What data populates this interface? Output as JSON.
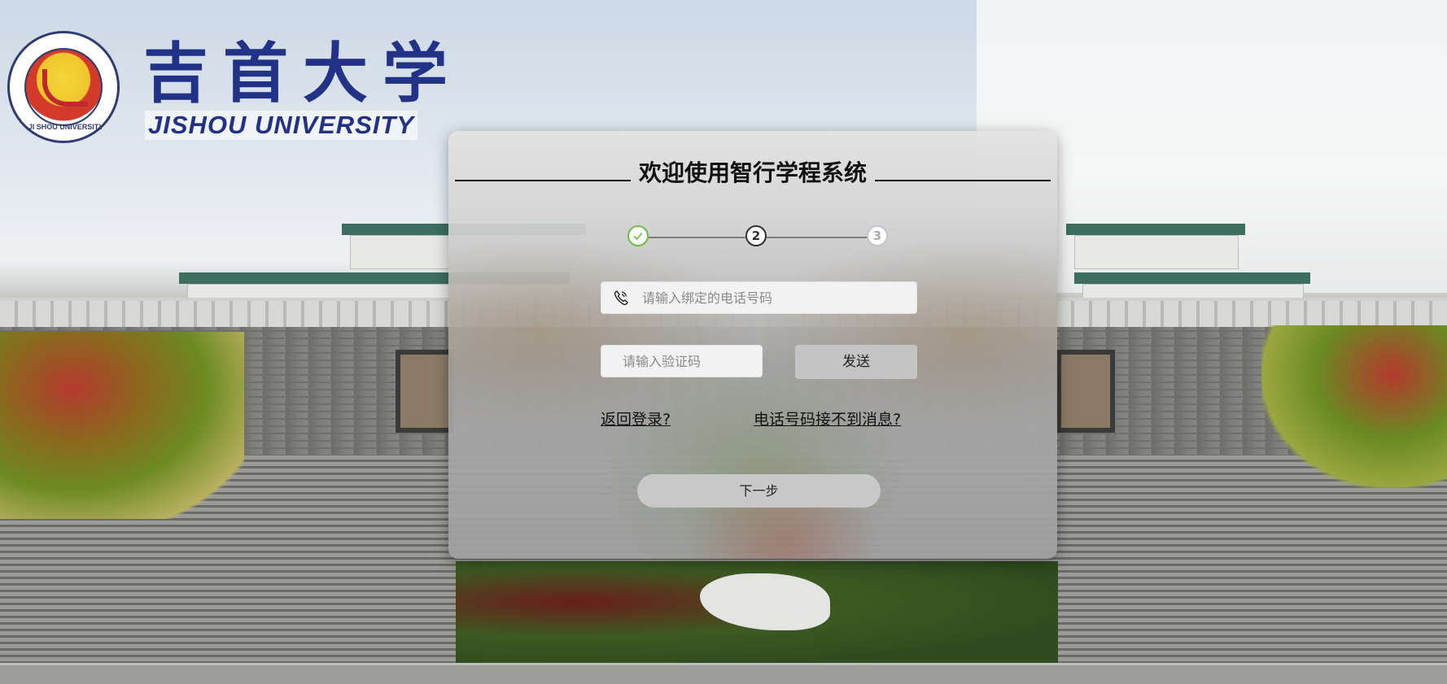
{
  "logo": {
    "chinese_name": "吉首大学",
    "english_name": "JISHOU  UNIVERSITY",
    "seal_text": "JI SHOU UNIVERSITY"
  },
  "card": {
    "title": "欢迎使用智行学程系统",
    "steps": [
      {
        "label": "✓",
        "state": "done"
      },
      {
        "label": "2",
        "state": "active"
      },
      {
        "label": "3",
        "state": "todo"
      }
    ],
    "phone_input": {
      "placeholder": "请输入绑定的电话号码",
      "value": ""
    },
    "code_input": {
      "placeholder": "请输入验证码",
      "value": ""
    },
    "send_button": "发送",
    "back_link": "返回登录?",
    "no_message_link": "电话号码接不到消息?",
    "next_button": "下一步"
  },
  "colors": {
    "step_done": "#67c23a",
    "step_active": "#303133",
    "step_todo": "#c0c4cc",
    "logo_blue": "#213287"
  },
  "icons": {
    "phone": "phone-icon",
    "check": "check-icon"
  }
}
